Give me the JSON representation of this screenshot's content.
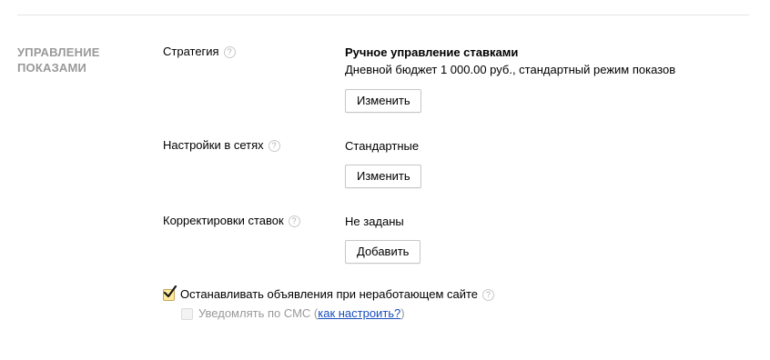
{
  "section": {
    "title_line1": "Управление",
    "title_line2": "показами"
  },
  "strategy": {
    "label": "Стратегия",
    "help_glyph": "?",
    "value_title": "Ручное управление ставками",
    "value_detail": "Дневной бюджет 1 000.00 руб., стандартный режим показов",
    "button_label": "Изменить"
  },
  "network_settings": {
    "label": "Настройки в сетях",
    "help_glyph": "?",
    "value": "Стандартные",
    "button_label": "Изменить"
  },
  "bid_adjustments": {
    "label": "Корректировки ставок",
    "help_glyph": "?",
    "value": "Не заданы",
    "button_label": "Добавить"
  },
  "stop_ads": {
    "checked": true,
    "label": "Останавливать объявления при неработающем сайте",
    "help_glyph": "?"
  },
  "sms_notify": {
    "checked": false,
    "disabled": true,
    "label_prefix": "Уведомлять по СМС (",
    "link_text": "как настроить?",
    "label_suffix": ")"
  },
  "colors": {
    "section_title": "#999999",
    "checkbox_checked_bg": "#ffeb9b",
    "link": "#1a4dbc",
    "muted_text": "#999999"
  },
  "icons": {
    "help": "question-circle-icon",
    "check": "checkmark-icon"
  }
}
